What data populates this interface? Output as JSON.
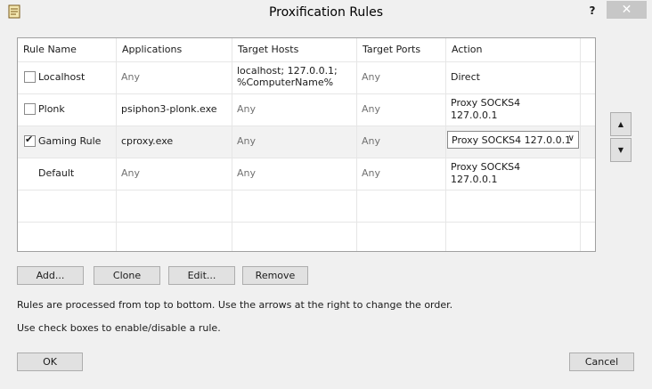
{
  "window": {
    "title": "Proxification Rules",
    "help_label": "?",
    "close_label": "✕"
  },
  "table": {
    "headers": [
      "Rule Name",
      "Applications",
      "Target Hosts",
      "Target Ports",
      "Action"
    ],
    "rows": [
      {
        "enabled": false,
        "name": "Localhost",
        "apps": "Any",
        "hosts_1": "localhost; 127.0.0.1;",
        "hosts_2": "%ComputerName%",
        "ports": "Any",
        "action_1": "Direct",
        "action_2": ""
      },
      {
        "enabled": false,
        "name": "Plonk",
        "apps": "psiphon3-plonk.exe",
        "hosts_1": "Any",
        "hosts_2": "",
        "ports": "Any",
        "action_1": "Proxy SOCKS4",
        "action_2": "127.0.0.1"
      },
      {
        "enabled": true,
        "name": "Gaming Rule",
        "apps": "cproxy.exe",
        "hosts_1": "Any",
        "hosts_2": "",
        "ports": "Any",
        "action_1": "Proxy SOCKS4 127.0.0.1",
        "action_2": ""
      },
      {
        "enabled": null,
        "name": "Default",
        "apps": "Any",
        "hosts_1": "Any",
        "hosts_2": "",
        "ports": "Any",
        "action_1": "Proxy SOCKS4",
        "action_2": "127.0.0.1"
      }
    ],
    "selected_row": 2
  },
  "buttons": {
    "add": "Add...",
    "clone": "Clone",
    "edit": "Edit...",
    "remove": "Remove",
    "ok": "OK",
    "cancel": "Cancel",
    "move_up": "▲",
    "move_down": "▼"
  },
  "notes": {
    "order": "Rules are processed from top to bottom. Use the arrows at the right to change the order.",
    "checkbox": "Use check boxes to enable/disable a rule."
  },
  "colors": {
    "any_text": "#727272",
    "selected_row_bg": "#f2f2f2",
    "close_button_bg": "#c7c7c7"
  }
}
